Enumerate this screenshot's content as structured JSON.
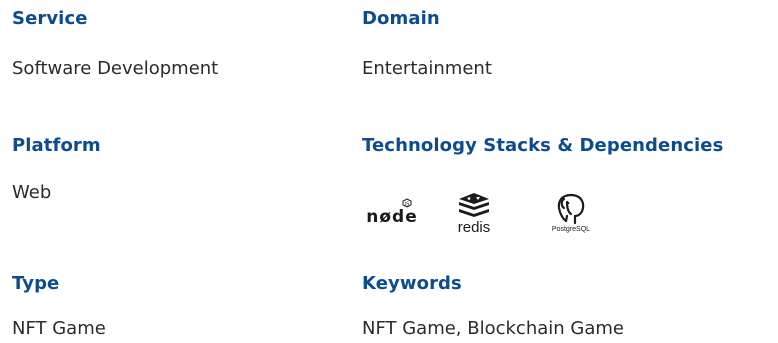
{
  "service": {
    "label": "Service",
    "value": "Software Development"
  },
  "domain": {
    "label": "Domain",
    "value": "Entertainment"
  },
  "platform": {
    "label": "Platform",
    "value": "Web"
  },
  "tech": {
    "label": "Technology Stacks & Dependencies",
    "logos": [
      {
        "name": "node",
        "text": "nøde",
        "icon": "nodejs-logo"
      },
      {
        "name": "redis",
        "text": "redis",
        "icon": "redis-logo"
      },
      {
        "name": "postgresql",
        "text": "PostgreSQL",
        "icon": "postgresql-elephant-logo"
      }
    ]
  },
  "type": {
    "label": "Type",
    "value": "NFT Game"
  },
  "keywords": {
    "label": "Keywords",
    "value": "NFT Game, Blockchain Game"
  },
  "colors": {
    "label": "#0d4b91",
    "text": "#2b2b2b"
  }
}
